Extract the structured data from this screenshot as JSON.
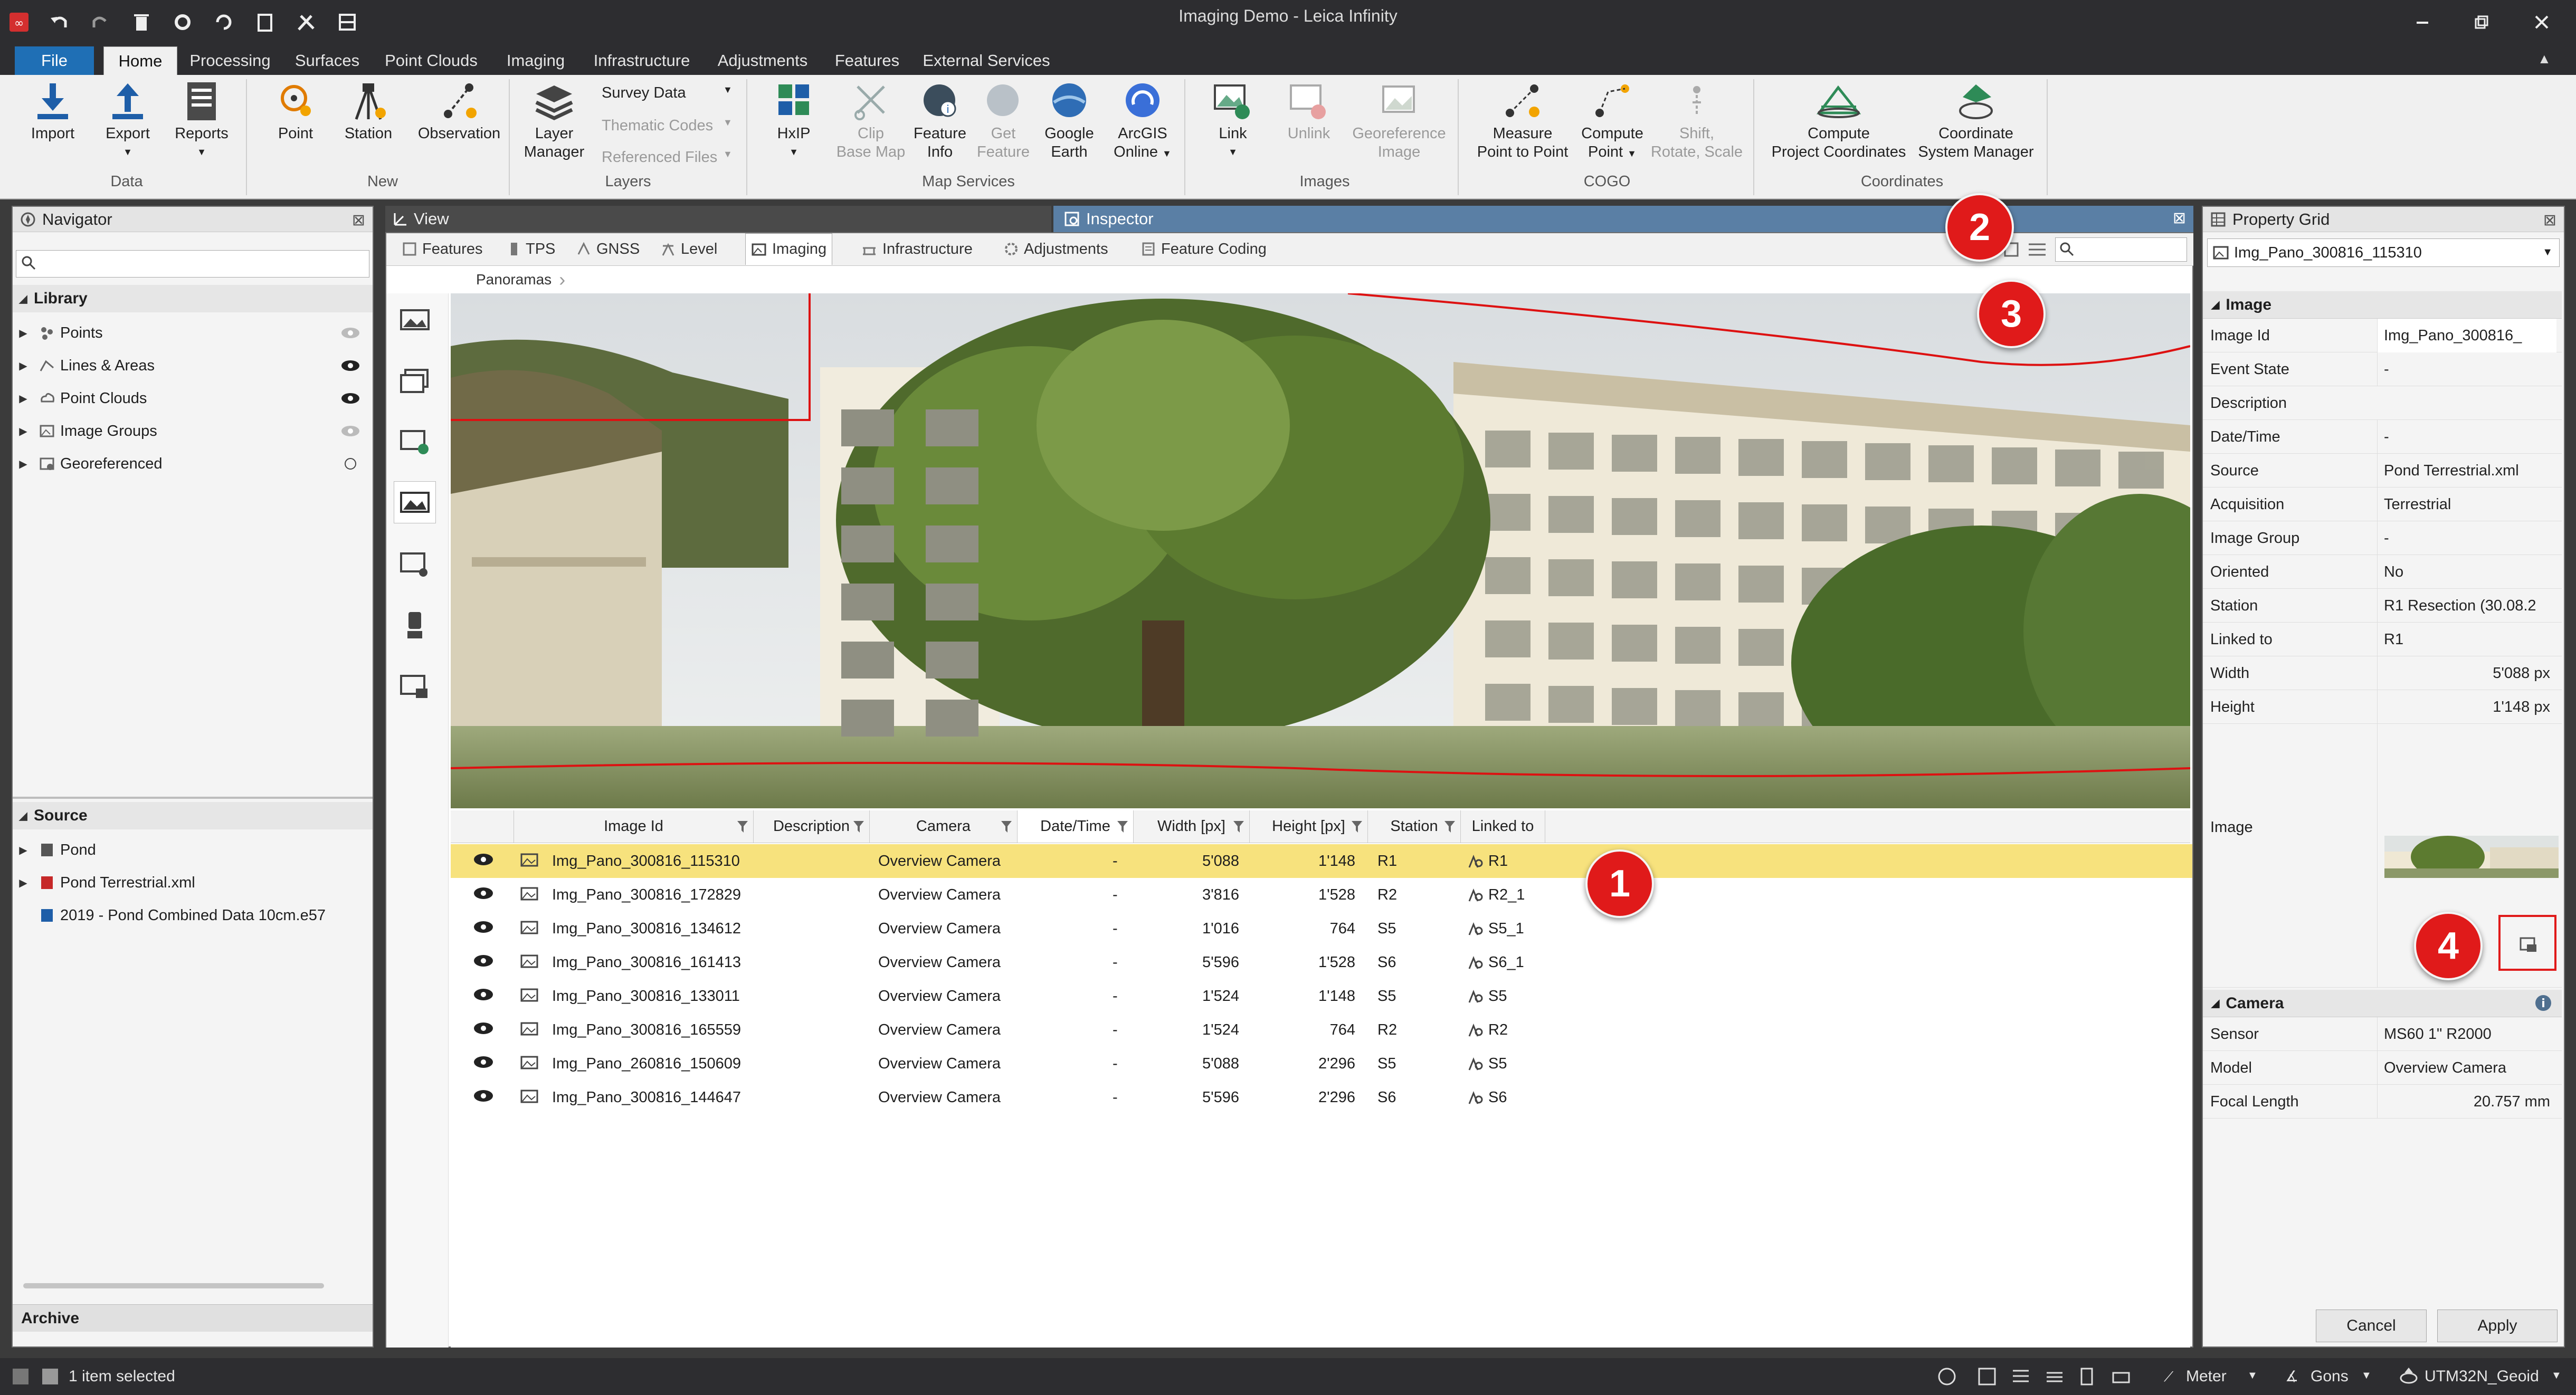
{
  "app": {
    "title": "Imaging Demo - Leica Infinity"
  },
  "menu_tabs": [
    "File",
    "Home",
    "Processing",
    "Surfaces",
    "Point Clouds",
    "Imaging",
    "Infrastructure",
    "Adjustments",
    "Features",
    "External Services"
  ],
  "ribbon": {
    "data": {
      "group": "Data",
      "import": "Import",
      "export": "Export",
      "reports": "Reports"
    },
    "new": {
      "group": "New",
      "point": "Point",
      "station": "Station",
      "observation": "Observation"
    },
    "layers": {
      "group": "Layers",
      "layer_manager_1": "Layer",
      "layer_manager_2": "Manager",
      "survey_data": "Survey Data",
      "thematic_codes": "Thematic Codes",
      "referenced_files": "Referenced Files"
    },
    "map_services": {
      "group": "Map Services",
      "hxip": "HxIP",
      "clip_1": "Clip",
      "clip_2": "Base Map",
      "feature_info_1": "Feature",
      "feature_info_2": "Info",
      "get_feature_1": "Get",
      "get_feature_2": "Feature",
      "google_1": "Google",
      "google_2": "Earth",
      "arcgis_1": "ArcGIS",
      "arcgis_2": "Online"
    },
    "images": {
      "group": "Images",
      "link": "Link",
      "unlink": "Unlink",
      "georef_1": "Georeference",
      "georef_2": "Image"
    },
    "cogo": {
      "group": "COGO",
      "measure_1": "Measure",
      "measure_2": "Point to Point",
      "compute_1": "Compute",
      "compute_2": "Point",
      "shift_1": "Shift,",
      "shift_2": "Rotate, Scale"
    },
    "coordinates": {
      "group": "Coordinates",
      "cpc_1": "Compute",
      "cpc_2": "Project Coordinates",
      "csm_1": "Coordinate",
      "csm_2": "System Manager"
    }
  },
  "navigator": {
    "title": "Navigator",
    "library_label": "Library",
    "library_items": [
      {
        "label": "Points",
        "icon": "points-icon"
      },
      {
        "label": "Lines & Areas",
        "icon": "lines-areas-icon"
      },
      {
        "label": "Point Clouds",
        "icon": "point-clouds-icon"
      },
      {
        "label": "Image Groups",
        "icon": "image-groups-icon"
      },
      {
        "label": "Georeferenced",
        "icon": "georeferenced-icon"
      }
    ],
    "source_label": "Source",
    "source_items": [
      {
        "label": "Pond"
      },
      {
        "label": "Pond Terrestrial.xml"
      },
      {
        "label": "2019 - Pond Combined Data 10cm.e57"
      }
    ],
    "archive_label": "Archive"
  },
  "view": {
    "title": "View"
  },
  "inspector": {
    "title": "Inspector",
    "tabs": [
      "Features",
      "TPS",
      "GNSS",
      "Level",
      "Imaging",
      "Infrastructure",
      "Adjustments",
      "Feature Coding"
    ],
    "breadcrumb": "Panoramas",
    "grid": {
      "columns": [
        "Image Id",
        "Description",
        "Camera",
        "Date/Time",
        "Width [px]",
        "Height [px]",
        "Station",
        "Linked to"
      ],
      "rows": [
        {
          "id": "Img_Pano_300816_115310",
          "camera": "Overview Camera",
          "datetime": "-",
          "width": "5'088",
          "height": "1'148",
          "station": "R1",
          "linked": "R1"
        },
        {
          "id": "Img_Pano_300816_172829",
          "camera": "Overview Camera",
          "datetime": "-",
          "width": "3'816",
          "height": "1'528",
          "station": "R2",
          "linked": "R2_1"
        },
        {
          "id": "Img_Pano_300816_134612",
          "camera": "Overview Camera",
          "datetime": "-",
          "width": "1'016",
          "height": "764",
          "station": "S5",
          "linked": "S5_1"
        },
        {
          "id": "Img_Pano_300816_161413",
          "camera": "Overview Camera",
          "datetime": "-",
          "width": "5'596",
          "height": "1'528",
          "station": "S6",
          "linked": "S6_1"
        },
        {
          "id": "Img_Pano_300816_133011",
          "camera": "Overview Camera",
          "datetime": "-",
          "width": "1'524",
          "height": "1'148",
          "station": "S5",
          "linked": "S5"
        },
        {
          "id": "Img_Pano_300816_165559",
          "camera": "Overview Camera",
          "datetime": "-",
          "width": "1'524",
          "height": "764",
          "station": "R2",
          "linked": "R2"
        },
        {
          "id": "Img_Pano_260816_150609",
          "camera": "Overview Camera",
          "datetime": "-",
          "width": "5'088",
          "height": "2'296",
          "station": "S5",
          "linked": "S5"
        },
        {
          "id": "Img_Pano_300816_144647",
          "camera": "Overview Camera",
          "datetime": "-",
          "width": "5'596",
          "height": "2'296",
          "station": "S6",
          "linked": "S6"
        }
      ]
    }
  },
  "property_grid": {
    "title": "Property Grid",
    "selected": "Img_Pano_300816_115310",
    "image_section": "Image",
    "image_rows": [
      {
        "k": "Image Id",
        "v": "Img_Pano_300816_"
      },
      {
        "k": "Event State",
        "v": "-"
      },
      {
        "k": "Description",
        "v": ""
      },
      {
        "k": "Date/Time",
        "v": "-"
      },
      {
        "k": "Source",
        "v": "Pond Terrestrial.xml"
      },
      {
        "k": "Acquisition",
        "v": "Terrestrial"
      },
      {
        "k": "Image Group",
        "v": "-"
      },
      {
        "k": "Oriented",
        "v": "No"
      },
      {
        "k": "Station",
        "v": "R1 Resection (30.08.2"
      },
      {
        "k": "Linked to",
        "v": "R1"
      },
      {
        "k": "Width",
        "v": "5'088  px"
      },
      {
        "k": "Height",
        "v": "1'148  px"
      }
    ],
    "image_label": "Image",
    "camera_section": "Camera",
    "camera_rows": [
      {
        "k": "Sensor",
        "v": "MS60 1\" R2000"
      },
      {
        "k": "Model",
        "v": "Overview Camera"
      },
      {
        "k": "Focal Length",
        "v": "20.757  mm"
      }
    ],
    "cancel": "Cancel",
    "apply": "Apply"
  },
  "callouts": [
    "1",
    "2",
    "3",
    "4"
  ],
  "status": {
    "selected": "1 item selected",
    "unit_distance": "Meter",
    "unit_angle": "Gons",
    "geoid": "UTM32N_Geoid"
  },
  "colors": {
    "selection": "#f7e27d",
    "accent": "#1f6fb5",
    "callout": "#e01a1a"
  }
}
